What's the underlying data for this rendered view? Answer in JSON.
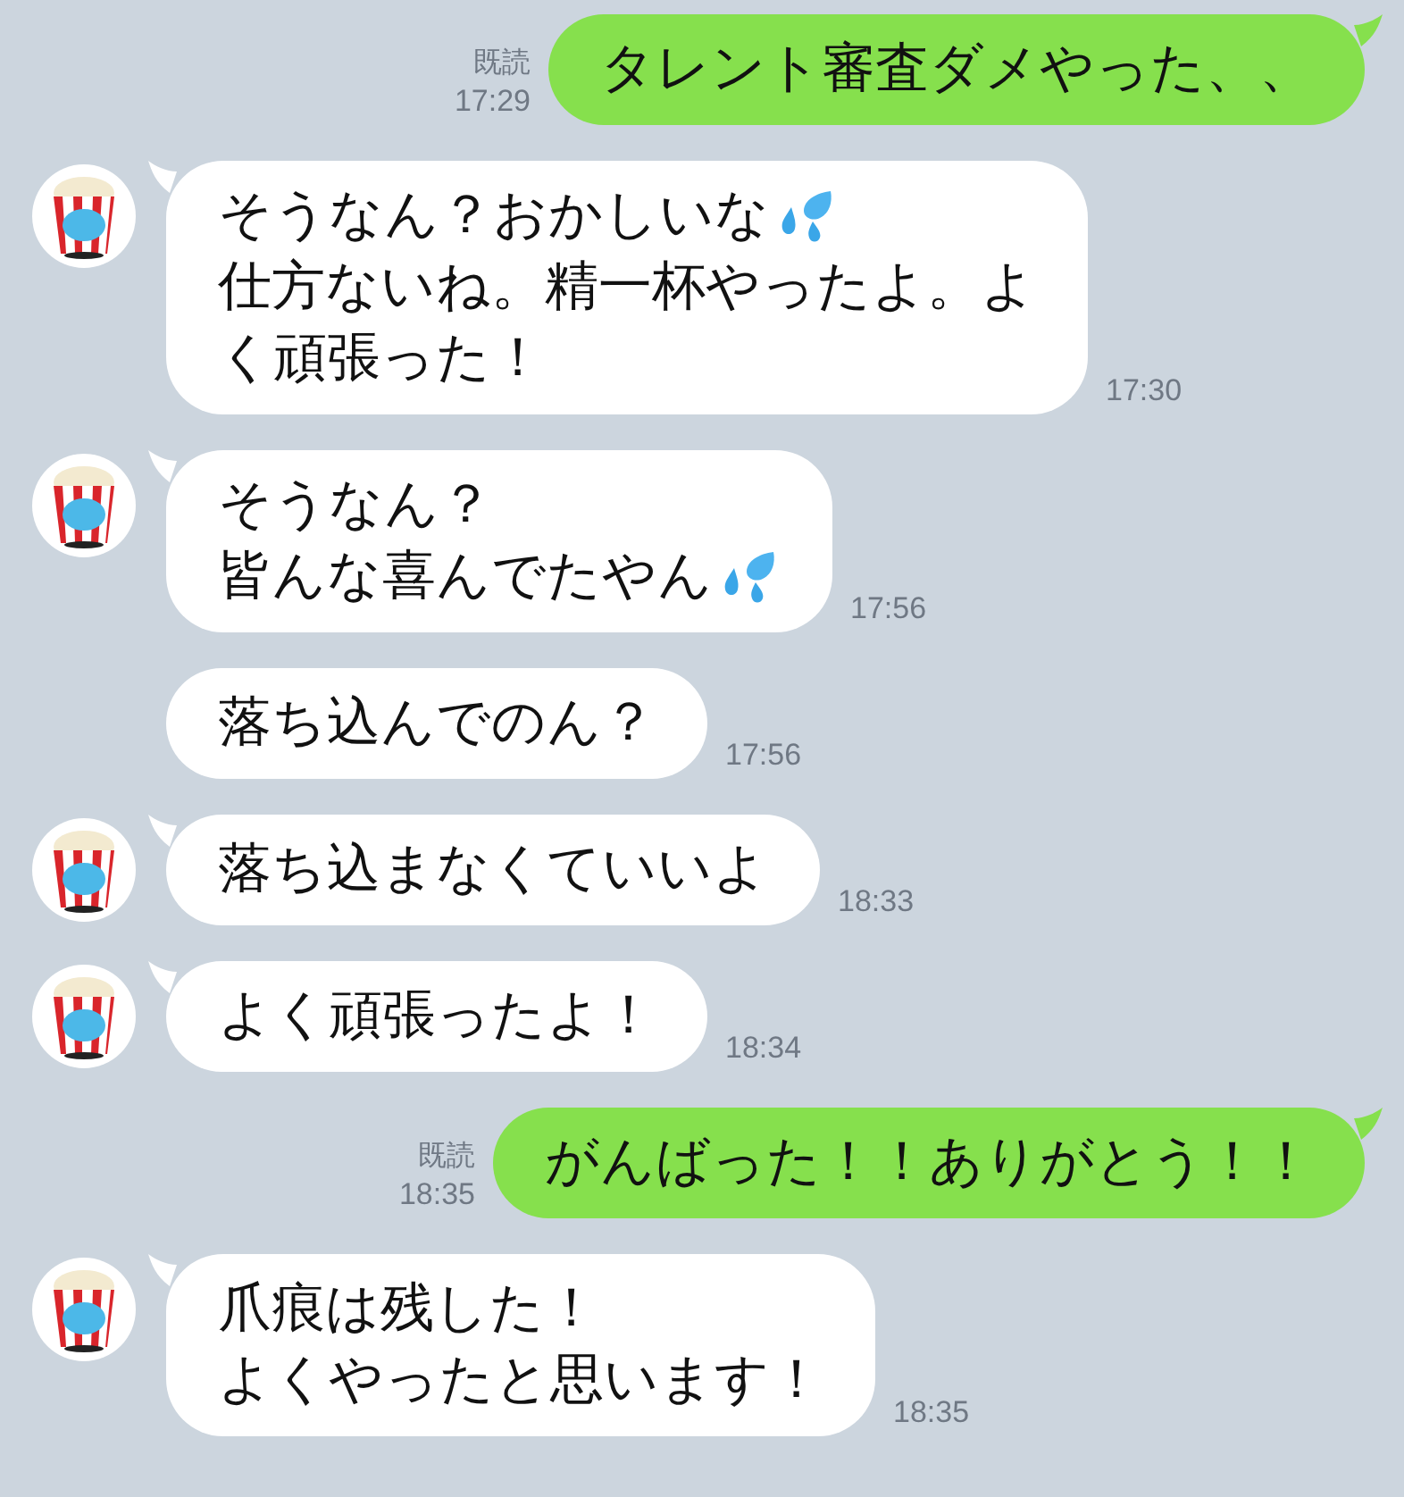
{
  "messages": [
    {
      "kind": "outgoing",
      "read": "既読",
      "time": "17:29",
      "lines": [
        {
          "text": "タレント審査ダメやった、、",
          "drop_icon": false
        }
      ]
    },
    {
      "kind": "incoming",
      "avatar": true,
      "time": "17:30",
      "lines": [
        {
          "text": "そうなん？おかしいな",
          "drop_icon": true
        },
        {
          "text": "仕方ないね。精一杯やったよ。よ",
          "drop_icon": false
        },
        {
          "text": "く頑張った！",
          "drop_icon": false
        }
      ]
    },
    {
      "kind": "incoming",
      "avatar": true,
      "time": "17:56",
      "lines": [
        {
          "text": "そうなん？",
          "drop_icon": false
        },
        {
          "text": "皆んな喜んでたやん",
          "drop_icon": true
        }
      ]
    },
    {
      "kind": "incoming",
      "avatar": false,
      "time": "17:56",
      "lines": [
        {
          "text": "落ち込んでのん？",
          "drop_icon": false
        }
      ]
    },
    {
      "kind": "incoming",
      "avatar": true,
      "time": "18:33",
      "lines": [
        {
          "text": "落ち込まなくていいよ",
          "drop_icon": false
        }
      ]
    },
    {
      "kind": "incoming",
      "avatar": true,
      "time": "18:34",
      "lines": [
        {
          "text": "よく頑張ったよ！",
          "drop_icon": false
        }
      ]
    },
    {
      "kind": "outgoing",
      "read": "既読",
      "time": "18:35",
      "lines": [
        {
          "text": "がんばった！！ありがとう！！",
          "drop_icon": false
        }
      ]
    },
    {
      "kind": "incoming",
      "avatar": true,
      "time": "18:35",
      "lines": [
        {
          "text": "爪痕は残した！",
          "drop_icon": false
        },
        {
          "text": "よくやったと思います！",
          "drop_icon": false
        }
      ]
    }
  ]
}
